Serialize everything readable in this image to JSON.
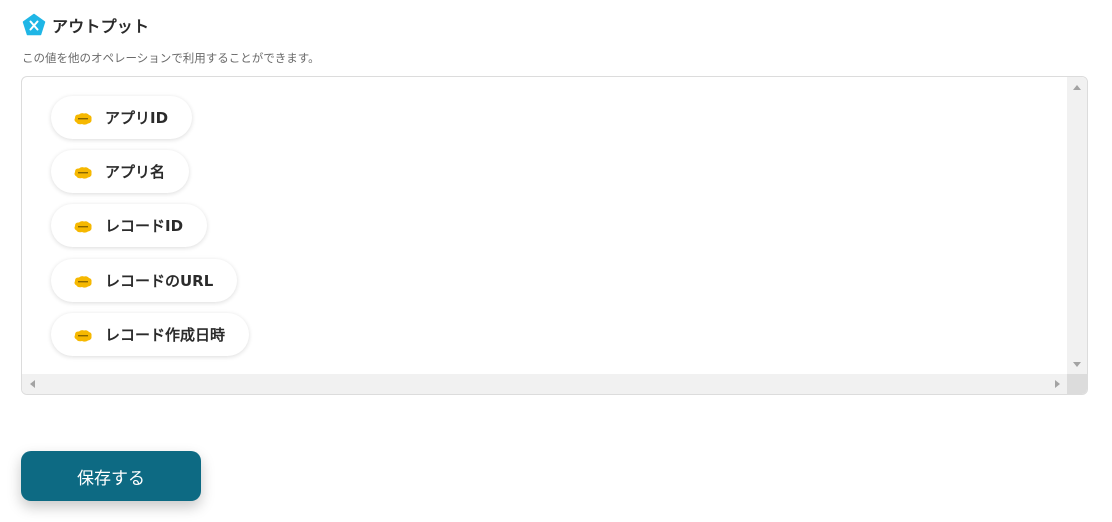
{
  "section": {
    "title": "アウトプット",
    "description": "この値を他のオペレーションで利用することができます。",
    "icon": "variable-x-icon",
    "icon_color": "#1fb6e6"
  },
  "outputs": [
    {
      "label": "アプリID",
      "icon": "kintone-icon"
    },
    {
      "label": "アプリ名",
      "icon": "kintone-icon"
    },
    {
      "label": "レコードID",
      "icon": "kintone-icon"
    },
    {
      "label": "レコードのURL",
      "icon": "kintone-icon"
    },
    {
      "label": "レコード作成日時",
      "icon": "kintone-icon"
    }
  ],
  "kintone_icon_color": "#f6b800",
  "save_button": {
    "label": "保存する",
    "color": "#0d6a83"
  }
}
